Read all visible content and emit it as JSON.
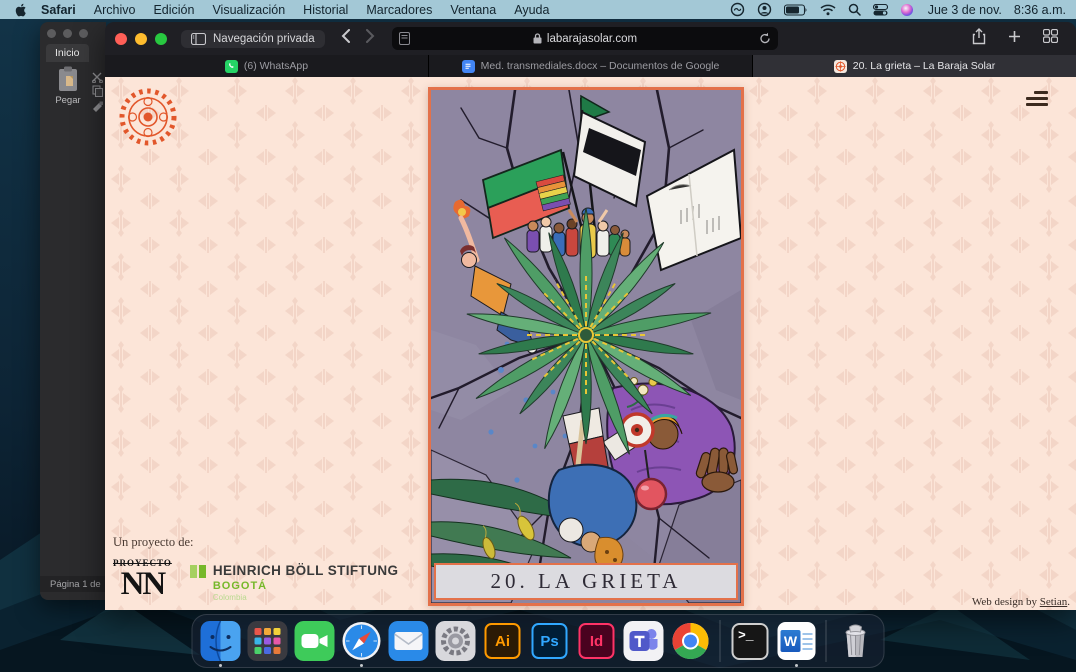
{
  "menubar": {
    "items": [
      "Safari",
      "Archivo",
      "Edición",
      "Visualización",
      "Historial",
      "Marcadores",
      "Ventana",
      "Ayuda"
    ],
    "date": "Jue 3 de nov.",
    "time": "8:36 a.m."
  },
  "word": {
    "ribbon_tab": "Inicio",
    "paste_label": "Pegar",
    "status": "Página 1 de"
  },
  "safari": {
    "private_label": "Navegación privada",
    "url": "labarajasolar.com",
    "tabs": [
      {
        "label": "(6) WhatsApp"
      },
      {
        "label": "Med. transmediales.docx – Documentos de Google"
      },
      {
        "label": "20. La grieta – La Baraja Solar"
      }
    ]
  },
  "page": {
    "card_title": "20. LA GRIETA",
    "project_label": "Un proyecto de:",
    "nn_top": "PROYECTO",
    "nn_main": "NN",
    "hbs_name": "HEINRICH BÖLL STIFTUNG",
    "hbs_city": "BOGOTÁ",
    "hbs_country": "Colombia",
    "credit_prefix": "Web design by ",
    "credit_link": "Setian",
    "credit_suffix": "."
  },
  "dock": {
    "ai": "Ai",
    "ps": "Ps",
    "id": "Id",
    "w": "W",
    "terminal_glyph": ">_"
  },
  "colors": {
    "page_bg": "#fce5d8",
    "card_border": "#e3714a",
    "card_bg": "#8e86a1",
    "logo_orange": "#e2572b",
    "hbs_green": "#76b82a",
    "menubar_bg": "#a3c8d6"
  }
}
